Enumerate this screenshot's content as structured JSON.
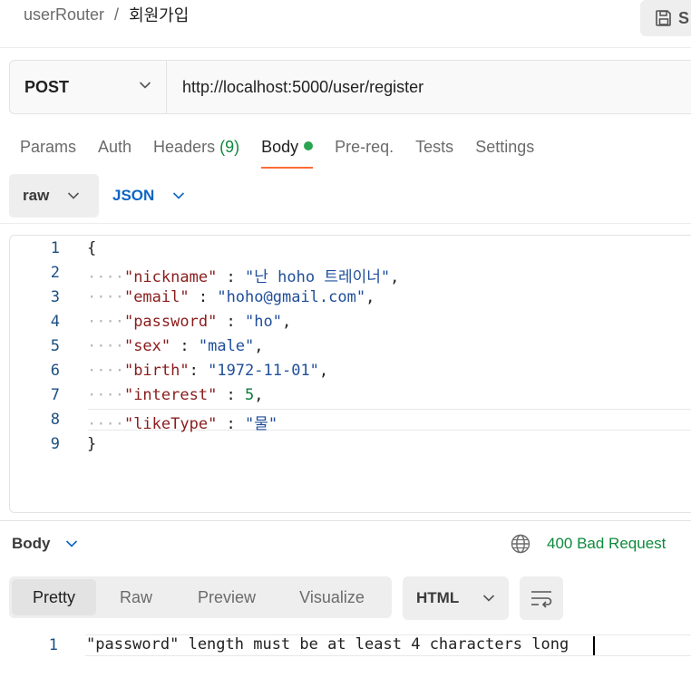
{
  "breadcrumb": {
    "parent": "userRouter",
    "separator": "/",
    "current": "회원가입"
  },
  "toolbar": {
    "save_label": "S",
    "save_icon": "floppy-disk-icon"
  },
  "request": {
    "method": "POST",
    "url": "http://localhost:5000/user/register"
  },
  "tabs": [
    {
      "label": "Params"
    },
    {
      "label": "Auth"
    },
    {
      "label": "Headers",
      "count": "(9)"
    },
    {
      "label": "Body",
      "active": true,
      "indicator": "green-dot"
    },
    {
      "label": "Pre-req."
    },
    {
      "label": "Tests"
    },
    {
      "label": "Settings"
    }
  ],
  "body_mode": {
    "type": "raw",
    "format": "JSON"
  },
  "editor": {
    "line_numbers": [
      "1",
      "2",
      "3",
      "4",
      "5",
      "6",
      "7",
      "8",
      "9"
    ],
    "open_brace": "{",
    "close_brace": "}",
    "fields": [
      {
        "key": "\"nickname\"",
        "sep": " : ",
        "value": "\"난 hoho 트레이너\"",
        "value_type": "string",
        "comma": ","
      },
      {
        "key": "\"email\"",
        "sep": " : ",
        "value": "\"hoho@gmail.com\"",
        "value_type": "string",
        "comma": ","
      },
      {
        "key": "\"password\"",
        "sep": " : ",
        "value": "\"ho\"",
        "value_type": "string",
        "comma": ","
      },
      {
        "key": "\"sex\"",
        "sep": " : ",
        "value": "\"male\"",
        "value_type": "string",
        "comma": ","
      },
      {
        "key": "\"birth\"",
        "sep": ": ",
        "value": "\"1972-11-01\"",
        "value_type": "string",
        "comma": ","
      },
      {
        "key": "\"interest\"",
        "sep": " : ",
        "value": "5",
        "value_type": "number",
        "comma": ","
      },
      {
        "key": "\"likeType\"",
        "sep": " : ",
        "value": "\"물\"",
        "value_type": "string",
        "comma": ""
      }
    ]
  },
  "response": {
    "label": "Body",
    "status": "400 Bad Request",
    "view_tabs": [
      "Pretty",
      "Raw",
      "Preview",
      "Visualize"
    ],
    "active_view": "Pretty",
    "format": "HTML",
    "line_number": "1",
    "text": "\"password\" length must be at least 4 characters long"
  },
  "colors": {
    "accent": "#ff6c37",
    "status_green": "#0d8a3c",
    "link_blue": "#0b65c2"
  }
}
